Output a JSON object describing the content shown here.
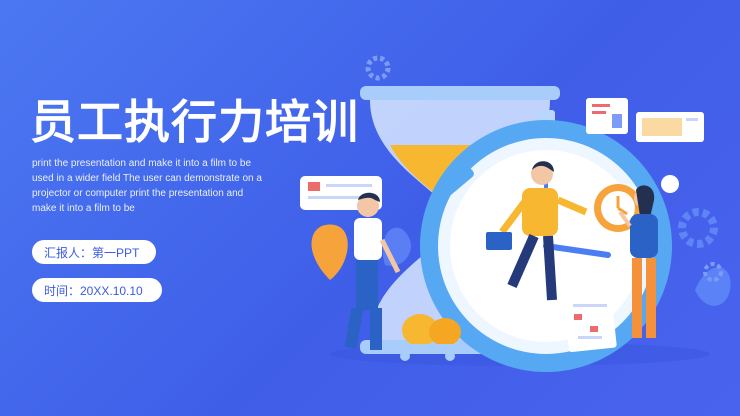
{
  "slide": {
    "title": "员工执行力培训",
    "description": "print the presentation and make it into a film to be used in a wider field The user can demonstrate on a projector or computer print the presentation and make it into a film to be",
    "reporter_label": "汇报人：第一PPT",
    "time_label": "时间：20XX.10.10"
  },
  "colors": {
    "background": "#4265ee",
    "accent_orange": "#f7b731",
    "clock_blue": "#67b7f5"
  },
  "illustration": {
    "icons": [
      "gear-icon",
      "hourglass-icon",
      "stopwatch-icon",
      "calendar-icon",
      "chart-card-icon",
      "message-card-icon",
      "money-bag-icon"
    ]
  }
}
